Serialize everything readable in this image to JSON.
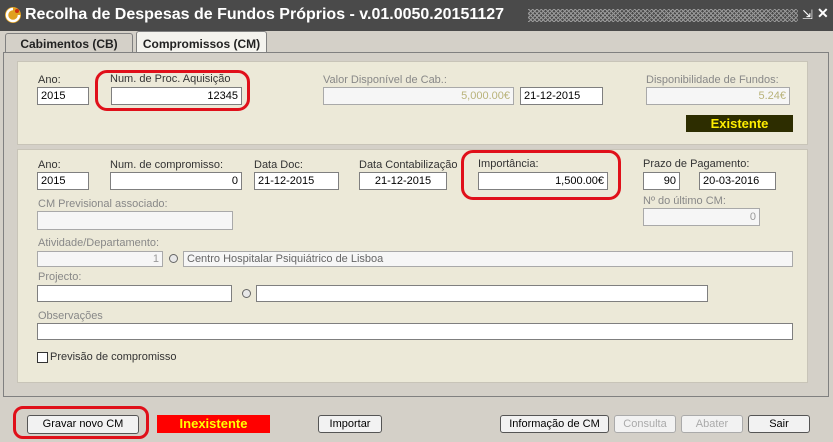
{
  "window": {
    "title": "Recolha de Despesas de Fundos Próprios - v.01.0050.20151127",
    "collapse_glyph": "⇲",
    "close_glyph": "✕"
  },
  "tabs": [
    {
      "label": "Cabimentos (CB)"
    },
    {
      "label": "Compromissos (CM)"
    }
  ],
  "top_section": {
    "ano_label": "Ano:",
    "ano_value": "2015",
    "proc_label": "Num. de Proc. Aquisição",
    "proc_value": "12345",
    "valor_label": "Valor Disponível de Cab.:",
    "valor_value": "5,000.00€",
    "valor_date": "21-12-2015",
    "disp_label": "Disponibilidade de Fundos:",
    "disp_value": "5.24€",
    "status": "Existente"
  },
  "bottom_section": {
    "ano_label": "Ano:",
    "ano_value": "2015",
    "num_comp_label": "Num. de compromisso:",
    "num_comp_value": "0",
    "data_doc_label": "Data Doc:",
    "data_doc_value": "21-12-2015",
    "data_cont_label": "Data Contabilização :",
    "data_cont_value": "21-12-2015",
    "importancia_label": "Importância:",
    "importancia_value": "1,500.00€",
    "prazo_label": "Prazo de Pagamento:",
    "prazo_days": "90",
    "prazo_date": "20-03-2016",
    "cm_prev_label": "CM Previsional associado:",
    "cm_prev_value": "",
    "ultimo_cm_label": "Nº do último CM:",
    "ultimo_cm_value": "0",
    "atividade_label": "Atividade/Departamento:",
    "atividade_code": "1",
    "atividade_name": "Centro Hospitalar Psiquiátrico de Lisboa",
    "projecto_label": "Projecto:",
    "projecto_code": "",
    "projecto_name": "",
    "observacoes_label": "Observações",
    "observacoes_value": "",
    "previsao_label": "Previsão de compromisso"
  },
  "footer": {
    "gravar_label": "Gravar novo CM",
    "status": "Inexistente",
    "importar_label": "Importar",
    "info_label": "Informação de CM",
    "consulta_label": "Consulta",
    "abater_label": "Abater",
    "sair_label": "Sair"
  }
}
